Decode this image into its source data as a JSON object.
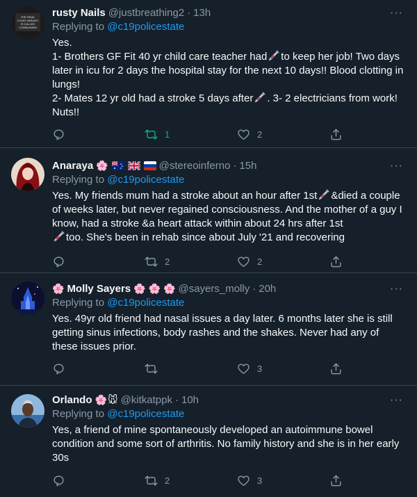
{
  "tweets": [
    {
      "name": "rusty Nails",
      "handle": "@justbreathing2",
      "time": "13h",
      "replying_prefix": "Replying to",
      "replying_to": "@c19policestate",
      "text_parts": [
        "Yes.\n1- Brothers GF Fit 40 yr child care teacher had",
        "to keep her job! Two days later in icu for 2 days the hospital stay for the next 10 days!! Blood clotting in lungs!\n2- Mates 12 yr old had a stroke 5 days after",
        ". 3- 2 electricians from work! Nuts!!"
      ],
      "replies": "",
      "retweets": "1",
      "likes": "2",
      "avatar_text": "THE FINAL COVID VARIANT IS CALLED COMMUNISM"
    },
    {
      "name": "Anaraya",
      "handle": "@stereoinferno",
      "time": "15h",
      "replying_prefix": "Replying to",
      "replying_to": "@c19policestate",
      "text_parts": [
        "Yes. My friends mum had a stroke about an hour after 1st",
        "&died a couple of weeks later, but never regained consciousness. And the mother of a guy I know, had a stroke &a heart attack within about 24 hrs after 1st",
        "too. She's been in rehab since about July '21 and recovering"
      ],
      "replies": "",
      "retweets": "2",
      "likes": "2"
    },
    {
      "name": "Molly Sayers",
      "handle": "@sayers_molly",
      "time": "20h",
      "replying_prefix": "Replying to",
      "replying_to": "@c19policestate",
      "text": "Yes. 49yr old friend had nasal issues a day later. 6 months later she is still getting sinus infections, body rashes and the shakes. Never had any of these issues prior.",
      "replies": "",
      "retweets": "",
      "likes": "3"
    },
    {
      "name": "Orlando",
      "handle": "@kitkatppk",
      "time": "10h",
      "replying_prefix": "Replying to",
      "replying_to": "@c19policestate",
      "text": "Yes, a friend of mine spontaneously developed an autoimmune bowel condition and some sort of arthritis. No family history and she is in her early 30s",
      "replies": "",
      "retweets": "2",
      "likes": "3"
    }
  ],
  "ui": {
    "more_glyph": "···",
    "dot_glyph": "·",
    "emoji_blossom": "🌸",
    "emoji_mouse": "🐭"
  },
  "colors": {
    "background": "#15202b",
    "divider": "#38444d",
    "text": "#f7f9f9",
    "muted": "#8b98a5",
    "link": "#1d9bf0",
    "retweet_active": "#00ba7c"
  }
}
